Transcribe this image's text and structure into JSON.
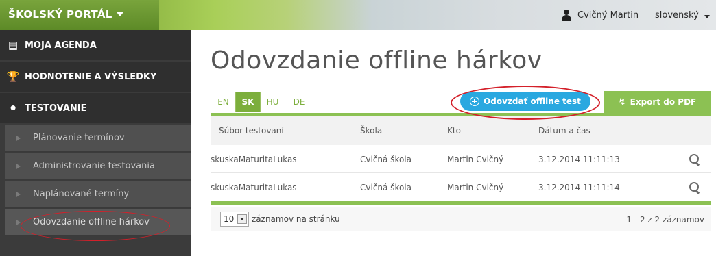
{
  "topbar": {
    "brand": "ŠKOLSKÝ PORTÁL",
    "user_name": "Cvičný Martin",
    "language": "slovenský"
  },
  "sidebar": {
    "main_items": [
      {
        "label": "MOJA AGENDA",
        "icon": "agenda-icon"
      },
      {
        "label": "HODNOTENIE A VÝSLEDKY",
        "icon": "trophy-icon"
      },
      {
        "label": "TESTOVANIE",
        "icon": "testing-icon"
      }
    ],
    "sub_items": [
      {
        "label": "Plánovanie termínov"
      },
      {
        "label": "Administrovanie testovania"
      },
      {
        "label": "Naplánované termíny"
      },
      {
        "label": "Odovzdanie offline hárkov"
      }
    ]
  },
  "main": {
    "title": "Odovzdanie offline hárkov",
    "language_tabs": [
      {
        "label": "EN",
        "active": false
      },
      {
        "label": "SK",
        "active": true
      },
      {
        "label": "HU",
        "active": false
      },
      {
        "label": "DE",
        "active": false
      }
    ],
    "upload_button": "Odovzdať offline test",
    "export_button": "Export do PDF",
    "table": {
      "columns": [
        "Súbor testovaní",
        "Škola",
        "Kto",
        "Dátum a čas"
      ],
      "rows": [
        [
          "skuskaMaturitaLukas",
          "Cvičná škola",
          "Martin Cvičný",
          "3.12.2014 11:11:13"
        ],
        [
          "skuskaMaturitaLukas",
          "Cvičná škola",
          "Martin Cvičný",
          "3.12.2014 11:11:14"
        ]
      ]
    },
    "footer": {
      "page_size": "10",
      "page_size_label": "záznamov na stránku",
      "paging_info": "1 - 2 z 2 záznamov"
    }
  },
  "colors": {
    "accent_green": "#8cc153",
    "accent_blue": "#29a8e0",
    "sidebar_bg": "#3b3b3b",
    "annotation_red": "#d4202a"
  }
}
